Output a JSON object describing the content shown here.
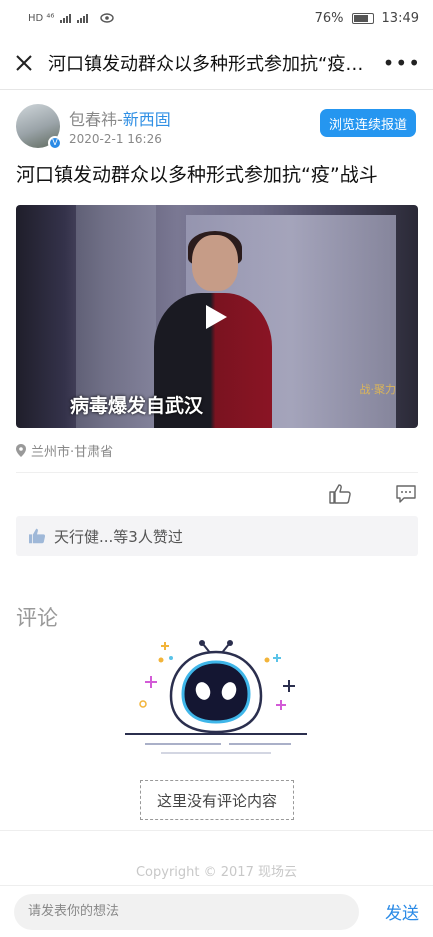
{
  "status_bar": {
    "left_indicators": "HD ⁴⁶",
    "battery": "76%",
    "time": "13:49"
  },
  "nav": {
    "title": "河口镇发动群众以多种形式参加抗“疫”...",
    "more": "•••"
  },
  "author": {
    "name": "包春祎",
    "separator": "-",
    "org": "新西固",
    "date": "2020-2-1 16:26",
    "verified_badge": "V",
    "follow_label": "浏览连续报道"
  },
  "article": {
    "title": "河口镇发动群众以多种形式参加抗“疫”战斗",
    "video_caption": "病毒爆发自武汉",
    "video_watermark": "战·聚力"
  },
  "location": {
    "text": "兰州市·甘肃省"
  },
  "likes": {
    "text": "天行健...等3人赞过"
  },
  "comments": {
    "section_title": "评论",
    "empty_text": "这里没有评论内容"
  },
  "footer": {
    "copyright": "Copyright © 2017 现场云"
  },
  "bottom_bar": {
    "input_placeholder": "请发表你的想法",
    "send_label": "发送"
  },
  "colors": {
    "accent": "#2596f0",
    "link_blue": "#2f8fe4"
  }
}
